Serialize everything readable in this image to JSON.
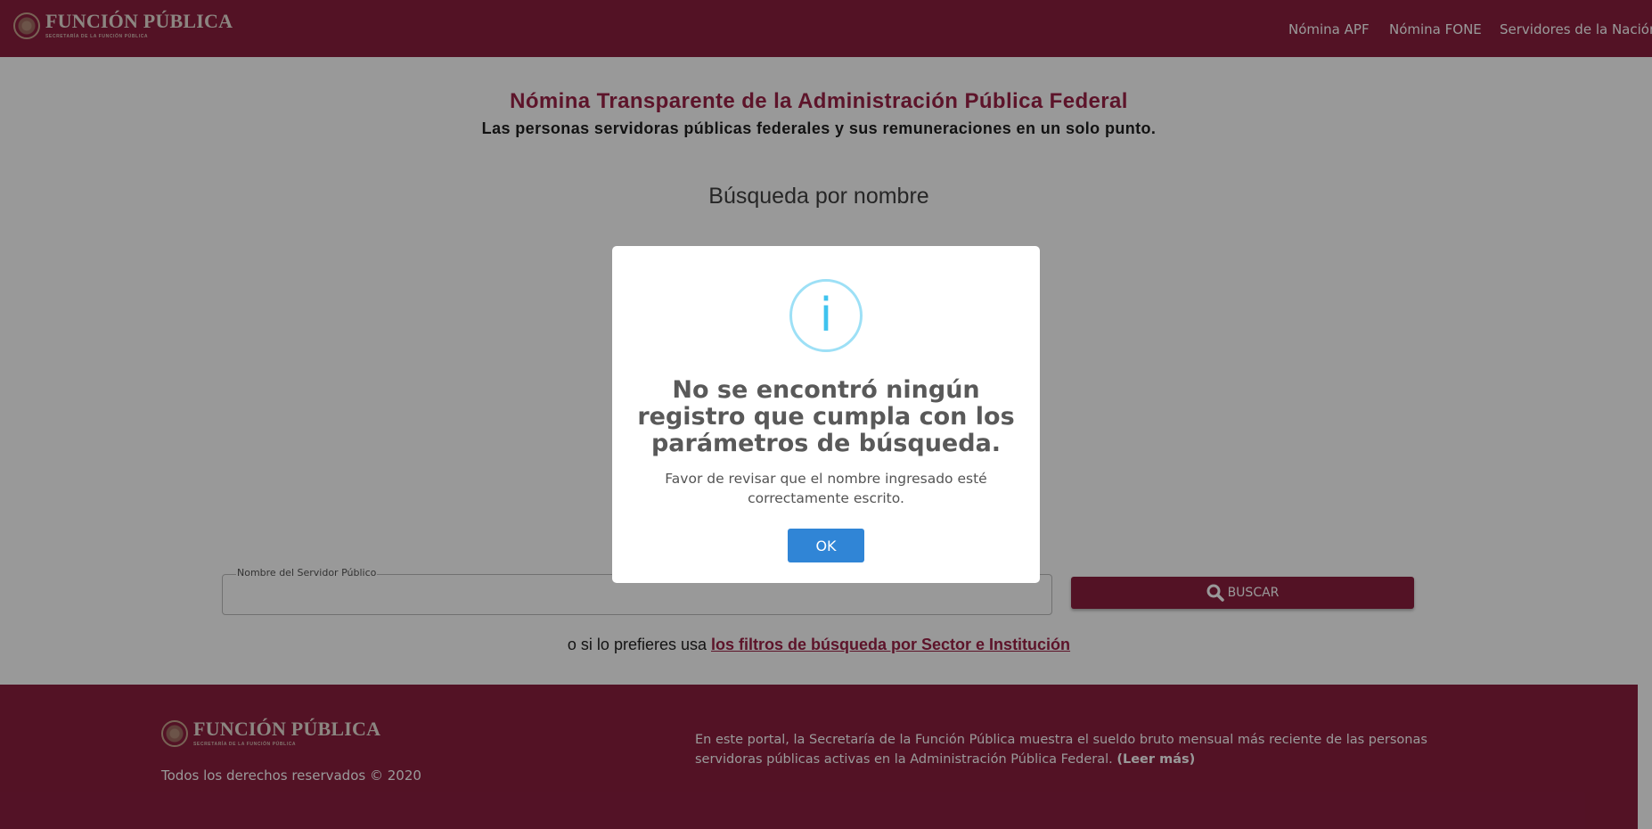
{
  "header": {
    "brand_name": "FUNCIÓN PÚBLICA",
    "brand_subtitle": "SECRETARÍA DE LA FUNCIÓN PÚBLICA",
    "nav": [
      "Nómina APF",
      "Nómina FONE",
      "Servidores de la Nación"
    ]
  },
  "main": {
    "title": "Nómina Transparente de la Administración Pública Federal",
    "subtitle": "Las personas servidoras públicas federales y sus remuneraciones en un solo punto.",
    "section_heading": "Búsqueda por nombre",
    "search_legend": "Nombre del Servidor Público",
    "search_value": "",
    "search_button_label": "BUSCAR",
    "alt_prefix": "o si lo prefieres usa ",
    "alt_link": "los filtros de búsqueda por Sector e Institución"
  },
  "footer": {
    "brand_name": "FUNCIÓN PÚBLICA",
    "brand_subtitle": "SECRETARÍA DE LA FUNCIÓN PÚBLICA",
    "copyright": "Todos los derechos reservados © 2020",
    "description": "En este portal, la Secretaría de la Función Pública muestra el sueldo bruto mensual más reciente de las personas servidoras públicas activas en la Administración Pública Federal.",
    "read_more": "(Leer más)"
  },
  "modal": {
    "icon_glyph": "i",
    "title": "No se encontró ningún registro que cumpla con los parámetros de búsqueda.",
    "text": "Favor de revisar que el nombre ingresado esté correctamente escrito.",
    "ok_label": "OK"
  },
  "colors": {
    "brand": "#8b1e3f",
    "title": "#9b2247",
    "info_icon": "#3fc3ee",
    "ok_button": "#3085d6"
  }
}
